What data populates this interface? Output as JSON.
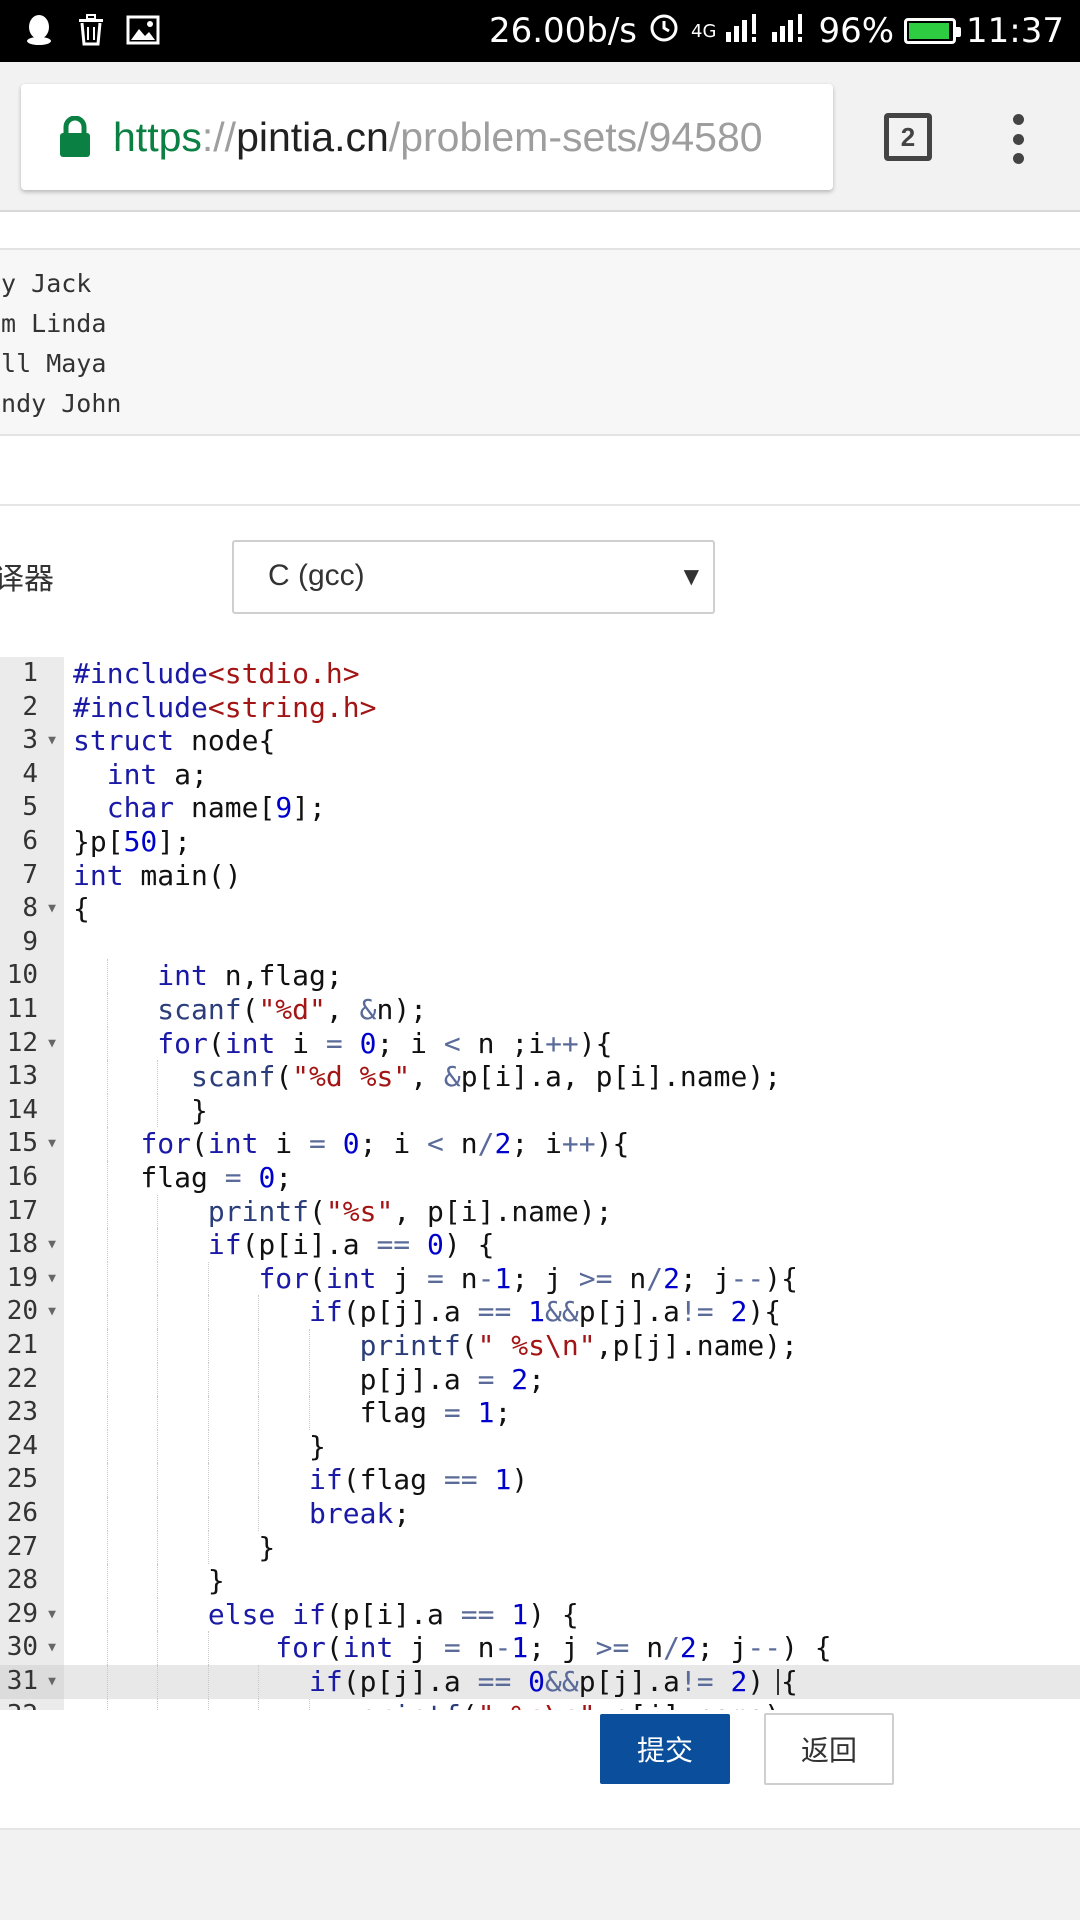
{
  "status_bar": {
    "icons_left": [
      "qq-icon",
      "trash-icon",
      "image-icon"
    ],
    "network_speed": "26.00b/s",
    "network_type": "4G",
    "battery_percent": "96%",
    "battery_level": 0.96,
    "time": "11:37"
  },
  "browser": {
    "url_scheme": "https",
    "url_sep": "://",
    "url_host": "pintia.cn",
    "url_path": "/problem-sets/94580",
    "tab_count": "2"
  },
  "sample_output": {
    "lines": [
      "my Jack",
      "om Linda",
      "ill Maya",
      "indy John"
    ]
  },
  "compiler": {
    "label": "译器",
    "selected": "C (gcc)",
    "arrow": "▼"
  },
  "editor": {
    "active_line": 31,
    "lines": [
      "#include<stdio.h>",
      "#include<string.h>",
      "struct node{",
      "  int a;",
      "  char name[9];",
      "}p[50];",
      "int main()",
      "{",
      "",
      "     int n,flag;",
      "     scanf(\"%d\", &n);",
      "     for(int i = 0; i < n ;i++){",
      "       scanf(\"%d %s\", &p[i].a, p[i].name);",
      "       }",
      "    for(int i = 0; i < n/2; i++){",
      "    flag = 0;",
      "        printf(\"%s\", p[i].name);",
      "        if(p[i].a == 0) {",
      "           for(int j = n-1; j >= n/2; j--){",
      "              if(p[j].a == 1&&p[j].a!= 2){",
      "                 printf(\" %s\\n\",p[j].name);",
      "                 p[j].a = 2;",
      "                 flag = 1;",
      "              }",
      "              if(flag == 1)",
      "              break;",
      "           }",
      "        }",
      "        else if(p[i].a == 1) {",
      "            for(int j = n-1; j >= n/2; j--) {",
      "              if(p[j].a == 0&&p[j].a!= 2) {",
      "                 printf(\" %s\\n\",p[j].name);"
    ]
  },
  "buttons": {
    "submit": "提交",
    "back": "返回"
  },
  "colors": {
    "keyword": "#1a1aa6",
    "string": "#a31515",
    "number": "#0000cd",
    "url_green": "#0b8043",
    "submit_bg": "#0b4f9c",
    "battery_green": "#2ecc40"
  }
}
